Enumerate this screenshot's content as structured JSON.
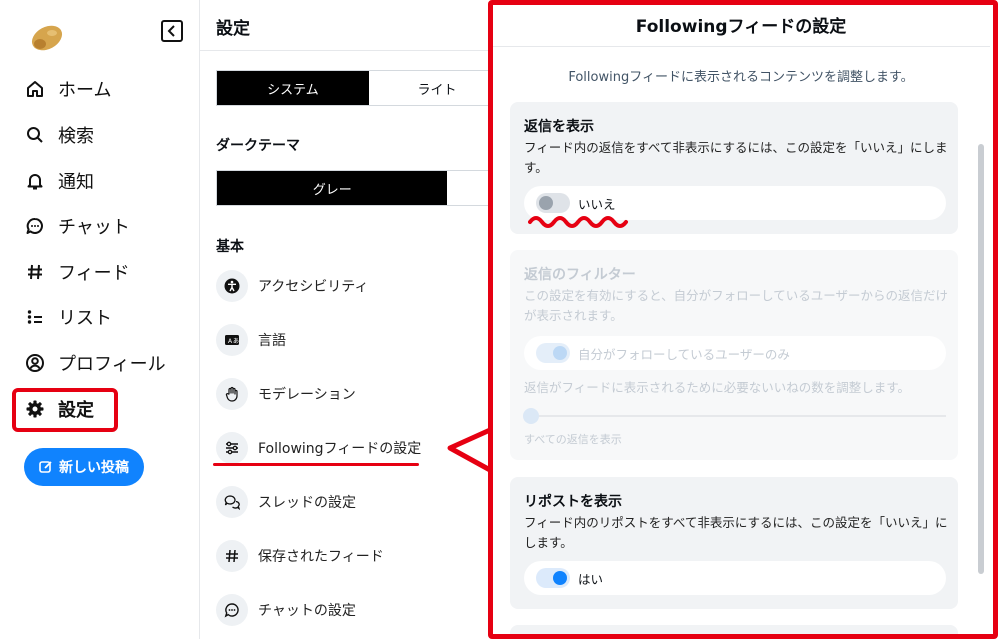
{
  "nav": {
    "items": [
      {
        "label": "ホーム",
        "icon": "home-icon"
      },
      {
        "label": "検索",
        "icon": "search-icon"
      },
      {
        "label": "通知",
        "icon": "bell-icon"
      },
      {
        "label": "チャット",
        "icon": "chat-icon"
      },
      {
        "label": "フィード",
        "icon": "hash-icon"
      },
      {
        "label": "リスト",
        "icon": "list-icon"
      },
      {
        "label": "プロフィール",
        "icon": "user-icon"
      },
      {
        "label": "設定",
        "icon": "gear-icon"
      }
    ],
    "new_post_label": "新しい投稿"
  },
  "settings": {
    "title": "設定",
    "mode_options": [
      "システム",
      "ライト"
    ],
    "mode_selected": "システム",
    "dark_theme_label": "ダークテーマ",
    "dark_theme_selected": "グレー",
    "basic_label": "基本",
    "rows": [
      {
        "label": "アクセシビリティ",
        "icon": "accessibility-icon"
      },
      {
        "label": "言語",
        "icon": "language-icon"
      },
      {
        "label": "モデレーション",
        "icon": "hand-icon"
      },
      {
        "label": "Followingフィードの設定",
        "icon": "sliders-icon"
      },
      {
        "label": "スレッドの設定",
        "icon": "threads-icon"
      },
      {
        "label": "保存されたフィード",
        "icon": "hash-icon"
      },
      {
        "label": "チャットの設定",
        "icon": "chat-icon"
      }
    ]
  },
  "modal": {
    "title": "Followingフィードの設定",
    "description": "Followingフィードに表示されるコンテンツを調整します。",
    "show_replies": {
      "title": "返信を表示",
      "text": "フィード内の返信をすべて非表示にするには、この設定を「いいえ」にします。",
      "toggle_label": "いいえ",
      "enabled": false
    },
    "reply_filter": {
      "title": "返信のフィルター",
      "text": "この設定を有効にすると、自分がフォローしているユーザーからの返信だけが表示されます。",
      "toggle_label": "自分がフォローしているユーザーのみ",
      "likes_text": "返信がフィードに表示されるために必要ないいねの数を調整します。",
      "slider_caption": "すべての返信を表示",
      "slider_value": 0
    },
    "show_reposts": {
      "title": "リポストを表示",
      "text": "フィード内のリポストをすべて非表示にするには、この設定を「いいえ」にします。",
      "toggle_label": "はい",
      "enabled": true
    }
  },
  "colors": {
    "accent": "#1083fe",
    "annotation_red": "#e60012"
  }
}
